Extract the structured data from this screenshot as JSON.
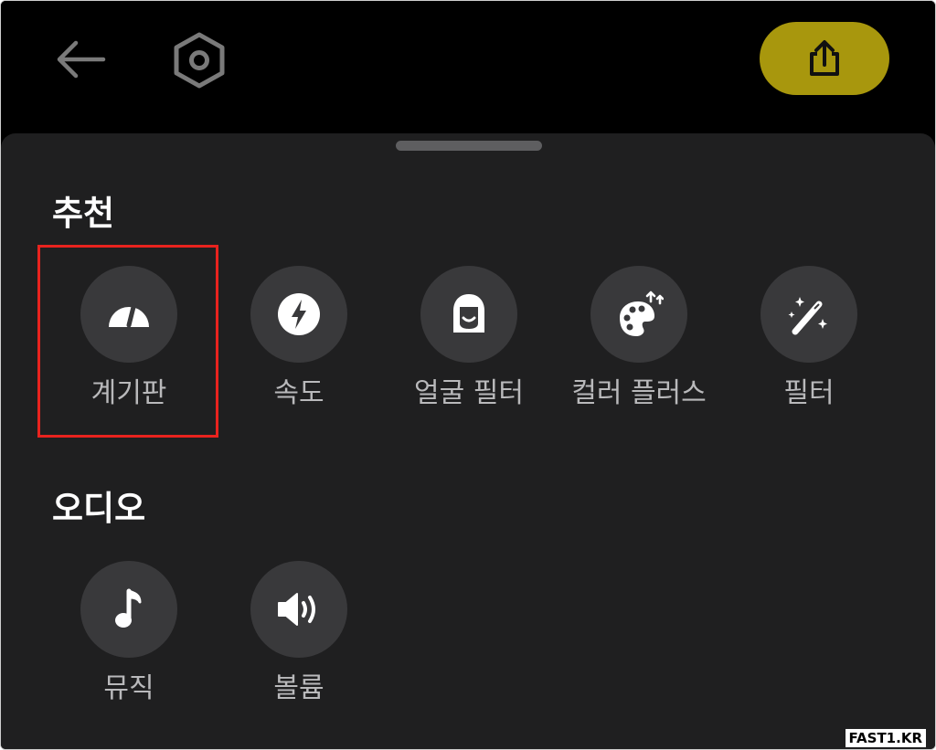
{
  "header": {
    "back_icon": "arrow-left-icon",
    "settings_icon": "hexagon-settings-icon",
    "share_icon": "share-upload-icon",
    "share_color": "#a8970d"
  },
  "sections": [
    {
      "title": "추천",
      "tools": [
        {
          "label": "계기판",
          "icon": "speedometer-icon",
          "highlighted": true
        },
        {
          "label": "속도",
          "icon": "lightning-icon"
        },
        {
          "label": "얼굴 필터",
          "icon": "face-filter-icon"
        },
        {
          "label": "컬러 플러스",
          "icon": "palette-icon"
        },
        {
          "label": "필터",
          "icon": "magic-wand-icon"
        }
      ]
    },
    {
      "title": "오디오",
      "tools": [
        {
          "label": "뮤직",
          "icon": "music-note-icon"
        },
        {
          "label": "볼륨",
          "icon": "volume-icon"
        }
      ]
    }
  ],
  "highlight_color": "#e8231e",
  "watermark": "FAST1.KR"
}
